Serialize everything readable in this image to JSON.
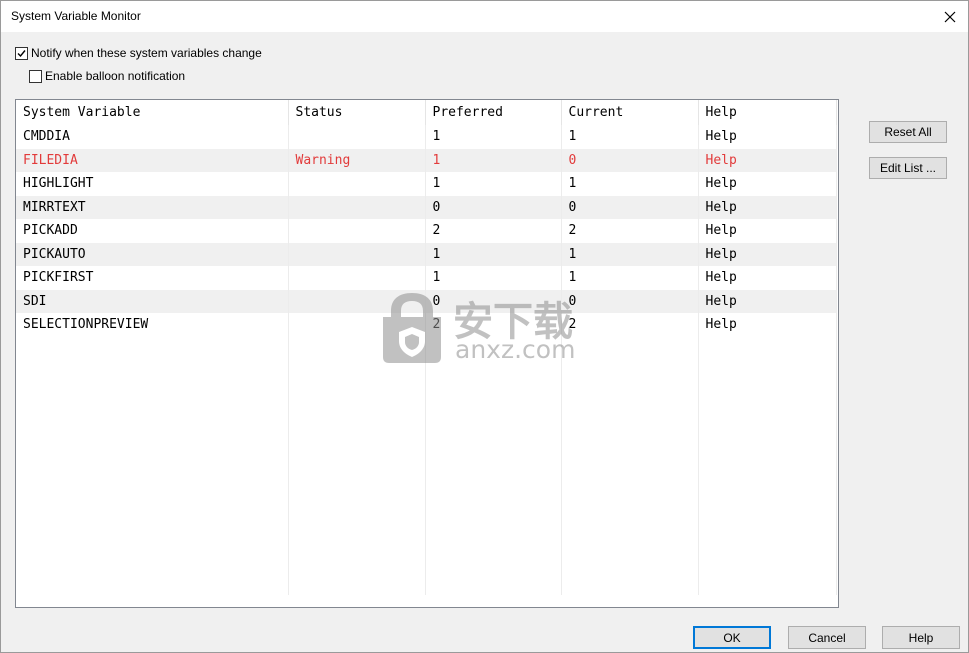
{
  "window": {
    "title": "System Variable Monitor"
  },
  "options": {
    "notify_label": "Notify when these system variables change",
    "notify_checked": true,
    "balloon_label": "Enable balloon notification",
    "balloon_checked": false
  },
  "table": {
    "columns": [
      "System Variable",
      "Status",
      "Preferred",
      "Current",
      "Help"
    ],
    "rows": [
      {
        "variable": "CMDDIA",
        "status": "",
        "preferred": "1",
        "current": "1",
        "help": "Help"
      },
      {
        "variable": "FILEDIA",
        "status": "Warning",
        "preferred": "1",
        "current": "0",
        "help": "Help"
      },
      {
        "variable": "HIGHLIGHT",
        "status": "",
        "preferred": "1",
        "current": "1",
        "help": "Help"
      },
      {
        "variable": "MIRRTEXT",
        "status": "",
        "preferred": "0",
        "current": "0",
        "help": "Help"
      },
      {
        "variable": "PICKADD",
        "status": "",
        "preferred": "2",
        "current": "2",
        "help": "Help"
      },
      {
        "variable": "PICKAUTO",
        "status": "",
        "preferred": "1",
        "current": "1",
        "help": "Help"
      },
      {
        "variable": "PICKFIRST",
        "status": "",
        "preferred": "1",
        "current": "1",
        "help": "Help"
      },
      {
        "variable": "SDI",
        "status": "",
        "preferred": "0",
        "current": "0",
        "help": "Help"
      },
      {
        "variable": "SELECTIONPREVIEW",
        "status": "",
        "preferred": "2",
        "current": "2",
        "help": "Help"
      }
    ],
    "warning_color": "#e23b3b"
  },
  "side_buttons": {
    "reset_all": "Reset All",
    "edit_list": "Edit List ..."
  },
  "footer_buttons": {
    "ok": "OK",
    "cancel": "Cancel",
    "help": "Help"
  },
  "watermark": {
    "brand": "安下载",
    "domain": "anxz.com"
  }
}
